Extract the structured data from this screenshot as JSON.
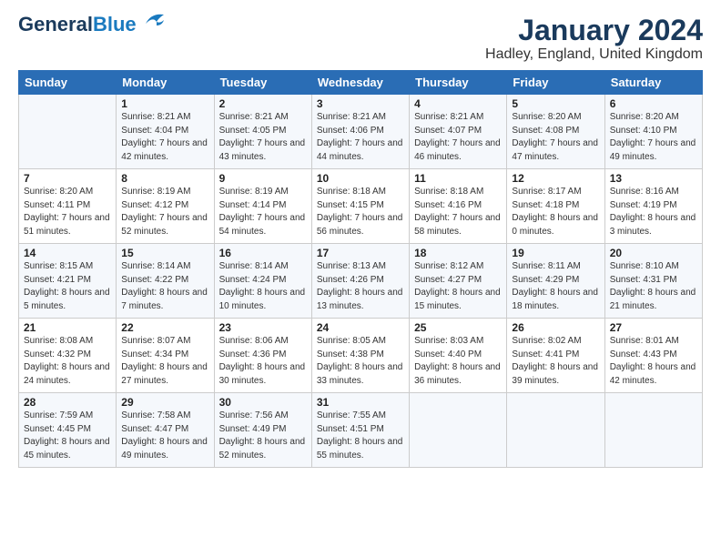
{
  "logo": {
    "general": "General",
    "blue": "Blue"
  },
  "header": {
    "title": "January 2024",
    "subtitle": "Hadley, England, United Kingdom"
  },
  "weekdays": [
    "Sunday",
    "Monday",
    "Tuesday",
    "Wednesday",
    "Thursday",
    "Friday",
    "Saturday"
  ],
  "weeks": [
    [
      {
        "day": "",
        "sunrise": "",
        "sunset": "",
        "daylight": ""
      },
      {
        "day": "1",
        "sunrise": "Sunrise: 8:21 AM",
        "sunset": "Sunset: 4:04 PM",
        "daylight": "Daylight: 7 hours and 42 minutes."
      },
      {
        "day": "2",
        "sunrise": "Sunrise: 8:21 AM",
        "sunset": "Sunset: 4:05 PM",
        "daylight": "Daylight: 7 hours and 43 minutes."
      },
      {
        "day": "3",
        "sunrise": "Sunrise: 8:21 AM",
        "sunset": "Sunset: 4:06 PM",
        "daylight": "Daylight: 7 hours and 44 minutes."
      },
      {
        "day": "4",
        "sunrise": "Sunrise: 8:21 AM",
        "sunset": "Sunset: 4:07 PM",
        "daylight": "Daylight: 7 hours and 46 minutes."
      },
      {
        "day": "5",
        "sunrise": "Sunrise: 8:20 AM",
        "sunset": "Sunset: 4:08 PM",
        "daylight": "Daylight: 7 hours and 47 minutes."
      },
      {
        "day": "6",
        "sunrise": "Sunrise: 8:20 AM",
        "sunset": "Sunset: 4:10 PM",
        "daylight": "Daylight: 7 hours and 49 minutes."
      }
    ],
    [
      {
        "day": "7",
        "sunrise": "Sunrise: 8:20 AM",
        "sunset": "Sunset: 4:11 PM",
        "daylight": "Daylight: 7 hours and 51 minutes."
      },
      {
        "day": "8",
        "sunrise": "Sunrise: 8:19 AM",
        "sunset": "Sunset: 4:12 PM",
        "daylight": "Daylight: 7 hours and 52 minutes."
      },
      {
        "day": "9",
        "sunrise": "Sunrise: 8:19 AM",
        "sunset": "Sunset: 4:14 PM",
        "daylight": "Daylight: 7 hours and 54 minutes."
      },
      {
        "day": "10",
        "sunrise": "Sunrise: 8:18 AM",
        "sunset": "Sunset: 4:15 PM",
        "daylight": "Daylight: 7 hours and 56 minutes."
      },
      {
        "day": "11",
        "sunrise": "Sunrise: 8:18 AM",
        "sunset": "Sunset: 4:16 PM",
        "daylight": "Daylight: 7 hours and 58 minutes."
      },
      {
        "day": "12",
        "sunrise": "Sunrise: 8:17 AM",
        "sunset": "Sunset: 4:18 PM",
        "daylight": "Daylight: 8 hours and 0 minutes."
      },
      {
        "day": "13",
        "sunrise": "Sunrise: 8:16 AM",
        "sunset": "Sunset: 4:19 PM",
        "daylight": "Daylight: 8 hours and 3 minutes."
      }
    ],
    [
      {
        "day": "14",
        "sunrise": "Sunrise: 8:15 AM",
        "sunset": "Sunset: 4:21 PM",
        "daylight": "Daylight: 8 hours and 5 minutes."
      },
      {
        "day": "15",
        "sunrise": "Sunrise: 8:14 AM",
        "sunset": "Sunset: 4:22 PM",
        "daylight": "Daylight: 8 hours and 7 minutes."
      },
      {
        "day": "16",
        "sunrise": "Sunrise: 8:14 AM",
        "sunset": "Sunset: 4:24 PM",
        "daylight": "Daylight: 8 hours and 10 minutes."
      },
      {
        "day": "17",
        "sunrise": "Sunrise: 8:13 AM",
        "sunset": "Sunset: 4:26 PM",
        "daylight": "Daylight: 8 hours and 13 minutes."
      },
      {
        "day": "18",
        "sunrise": "Sunrise: 8:12 AM",
        "sunset": "Sunset: 4:27 PM",
        "daylight": "Daylight: 8 hours and 15 minutes."
      },
      {
        "day": "19",
        "sunrise": "Sunrise: 8:11 AM",
        "sunset": "Sunset: 4:29 PM",
        "daylight": "Daylight: 8 hours and 18 minutes."
      },
      {
        "day": "20",
        "sunrise": "Sunrise: 8:10 AM",
        "sunset": "Sunset: 4:31 PM",
        "daylight": "Daylight: 8 hours and 21 minutes."
      }
    ],
    [
      {
        "day": "21",
        "sunrise": "Sunrise: 8:08 AM",
        "sunset": "Sunset: 4:32 PM",
        "daylight": "Daylight: 8 hours and 24 minutes."
      },
      {
        "day": "22",
        "sunrise": "Sunrise: 8:07 AM",
        "sunset": "Sunset: 4:34 PM",
        "daylight": "Daylight: 8 hours and 27 minutes."
      },
      {
        "day": "23",
        "sunrise": "Sunrise: 8:06 AM",
        "sunset": "Sunset: 4:36 PM",
        "daylight": "Daylight: 8 hours and 30 minutes."
      },
      {
        "day": "24",
        "sunrise": "Sunrise: 8:05 AM",
        "sunset": "Sunset: 4:38 PM",
        "daylight": "Daylight: 8 hours and 33 minutes."
      },
      {
        "day": "25",
        "sunrise": "Sunrise: 8:03 AM",
        "sunset": "Sunset: 4:40 PM",
        "daylight": "Daylight: 8 hours and 36 minutes."
      },
      {
        "day": "26",
        "sunrise": "Sunrise: 8:02 AM",
        "sunset": "Sunset: 4:41 PM",
        "daylight": "Daylight: 8 hours and 39 minutes."
      },
      {
        "day": "27",
        "sunrise": "Sunrise: 8:01 AM",
        "sunset": "Sunset: 4:43 PM",
        "daylight": "Daylight: 8 hours and 42 minutes."
      }
    ],
    [
      {
        "day": "28",
        "sunrise": "Sunrise: 7:59 AM",
        "sunset": "Sunset: 4:45 PM",
        "daylight": "Daylight: 8 hours and 45 minutes."
      },
      {
        "day": "29",
        "sunrise": "Sunrise: 7:58 AM",
        "sunset": "Sunset: 4:47 PM",
        "daylight": "Daylight: 8 hours and 49 minutes."
      },
      {
        "day": "30",
        "sunrise": "Sunrise: 7:56 AM",
        "sunset": "Sunset: 4:49 PM",
        "daylight": "Daylight: 8 hours and 52 minutes."
      },
      {
        "day": "31",
        "sunrise": "Sunrise: 7:55 AM",
        "sunset": "Sunset: 4:51 PM",
        "daylight": "Daylight: 8 hours and 55 minutes."
      },
      {
        "day": "",
        "sunrise": "",
        "sunset": "",
        "daylight": ""
      },
      {
        "day": "",
        "sunrise": "",
        "sunset": "",
        "daylight": ""
      },
      {
        "day": "",
        "sunrise": "",
        "sunset": "",
        "daylight": ""
      }
    ]
  ]
}
